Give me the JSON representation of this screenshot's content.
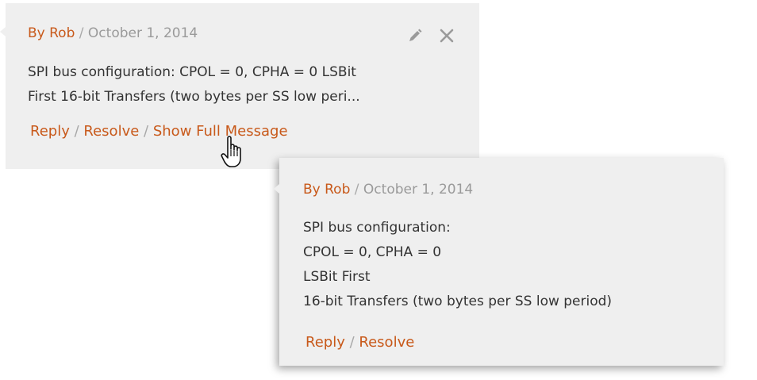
{
  "comment_collapsed": {
    "author": "By Rob",
    "separator": "/",
    "date": "October 1, 2014",
    "body_lines": [
      "SPI bus configuration: CPOL = 0, CPHA = 0 LSBit",
      "First 16-bit Transfers (two bytes per SS low peri..."
    ],
    "actions": {
      "reply": "Reply",
      "resolve": "Resolve",
      "show_full": "Show Full Message"
    },
    "icons": [
      "pencil-icon",
      "close-icon"
    ]
  },
  "comment_expanded": {
    "author": "By Rob",
    "separator": "/",
    "date": "October 1, 2014",
    "body_lines": [
      "SPI bus configuration:",
      "CPOL = 0, CPHA = 0",
      "LSBit First",
      "16-bit Transfers (two bytes per SS low period)"
    ],
    "actions": {
      "reply": "Reply",
      "resolve": "Resolve"
    }
  },
  "cursor": "hand-pointer-icon",
  "colors": {
    "accent": "#c8591a",
    "card_bg": "#efefef",
    "meta_text": "#9a9a9a",
    "body_text": "#333333"
  }
}
